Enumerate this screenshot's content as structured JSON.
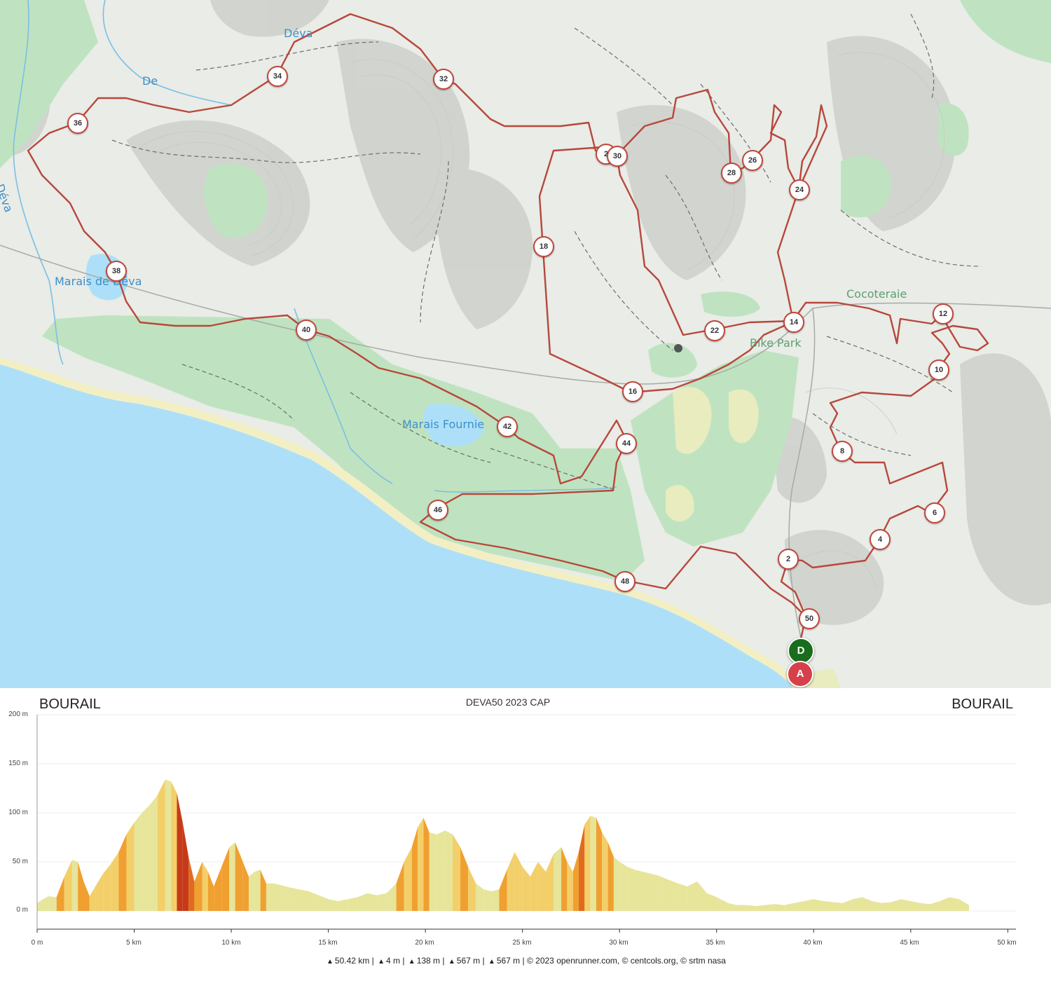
{
  "map": {
    "labels": {
      "deva_river_1": "Déva",
      "deva_river_2": "De",
      "deva_river_3": "Déva",
      "marais_deva": "Marais de Déva",
      "marais_fournier": "Marais Fournie",
      "cocoteraie": "Cocoteraie",
      "bike_park": "Bike Park"
    },
    "km_markers": [
      "2",
      "4",
      "6",
      "8",
      "10",
      "12",
      "14",
      "16",
      "18",
      "22",
      "24",
      "26",
      "28",
      "2",
      "30",
      "32",
      "34",
      "36",
      "38",
      "40",
      "42",
      "44",
      "46",
      "48",
      "50"
    ],
    "start_pin": "D",
    "finish_pin": "A",
    "colors": {
      "route": "#b8473b",
      "sea": "#ade0f8",
      "forest": "#bfe3c0",
      "land": "#e9ece7",
      "start": "#1a6d1d",
      "finish": "#d6404a"
    }
  },
  "profile": {
    "title": "DEVA50 2023 CAP",
    "start_place": "BOURAIL",
    "end_place": "BOURAIL",
    "footer": {
      "distance": "50.42 km",
      "min_alt": "4 m",
      "max_alt": "138 m",
      "ascent": "567 m",
      "descent": "567 m",
      "credits": "© 2023 openrunner.com, © centcols.org, © srtm nasa"
    }
  },
  "chart_data": {
    "type": "area",
    "title": "DEVA50 2023 CAP",
    "xlabel": "",
    "ylabel": "",
    "x_unit": "km",
    "y_unit": "m",
    "xlim": [
      0,
      50.42
    ],
    "ylim": [
      0,
      200
    ],
    "x_ticks": [
      "0 m",
      "5 km",
      "10 km",
      "15 km",
      "20 km",
      "25 km",
      "30 km",
      "35 km",
      "40 km",
      "45 km",
      "50 km"
    ],
    "y_ticks": [
      "200 m",
      "150 m",
      "100 m",
      "50 m",
      "0 m"
    ],
    "grid": true,
    "x": [
      0,
      0.3,
      0.6,
      1.0,
      1.4,
      1.8,
      2.1,
      2.4,
      2.7,
      3.0,
      3.4,
      3.8,
      4.2,
      4.6,
      5.0,
      5.4,
      5.8,
      6.2,
      6.6,
      6.9,
      7.2,
      7.5,
      7.8,
      8.1,
      8.5,
      8.8,
      9.1,
      9.5,
      9.9,
      10.2,
      10.6,
      10.9,
      11.2,
      11.5,
      11.8,
      12.2,
      12.6,
      13.0,
      13.5,
      14.0,
      14.5,
      15.0,
      15.5,
      16.0,
      16.5,
      17.0,
      17.5,
      18.0,
      18.5,
      18.9,
      19.3,
      19.6,
      19.9,
      20.2,
      20.6,
      21.0,
      21.4,
      21.8,
      22.2,
      22.6,
      23.0,
      23.4,
      23.8,
      24.2,
      24.6,
      25.0,
      25.4,
      25.8,
      26.2,
      26.6,
      27.0,
      27.3,
      27.6,
      27.9,
      28.2,
      28.5,
      28.8,
      29.1,
      29.4,
      29.7,
      30.0,
      30.4,
      30.8,
      31.2,
      31.6,
      32.0,
      32.5,
      33.0,
      33.5,
      34.0,
      34.5,
      34.9,
      35.2,
      35.6,
      36.0,
      36.5,
      37.0,
      37.5,
      38.0,
      38.5,
      39.0,
      39.5,
      40.0,
      40.5,
      41.0,
      41.5,
      42.0,
      42.5,
      43.0,
      43.5,
      44.0,
      44.5,
      45.0,
      45.5,
      46.0,
      46.5,
      47.0,
      47.5,
      48.0,
      48.5,
      49.0,
      49.5,
      49.9,
      50.2,
      50.42
    ],
    "y": [
      8,
      12,
      15,
      14,
      35,
      52,
      50,
      30,
      15,
      25,
      38,
      48,
      60,
      78,
      90,
      100,
      108,
      118,
      134,
      132,
      120,
      90,
      55,
      30,
      50,
      40,
      25,
      45,
      65,
      70,
      50,
      35,
      40,
      42,
      28,
      28,
      26,
      24,
      22,
      20,
      16,
      12,
      10,
      12,
      14,
      18,
      16,
      18,
      28,
      50,
      65,
      85,
      95,
      80,
      78,
      82,
      78,
      65,
      45,
      28,
      22,
      20,
      22,
      42,
      60,
      45,
      35,
      50,
      40,
      58,
      65,
      50,
      40,
      60,
      88,
      97,
      95,
      80,
      70,
      55,
      50,
      45,
      42,
      40,
      38,
      36,
      32,
      28,
      25,
      30,
      18,
      15,
      12,
      8,
      6,
      6,
      5,
      6,
      7,
      6,
      8,
      10,
      12,
      10,
      9,
      8,
      12,
      14,
      10,
      8,
      9,
      12,
      10,
      8,
      7,
      10,
      14,
      12,
      6
    ]
  }
}
